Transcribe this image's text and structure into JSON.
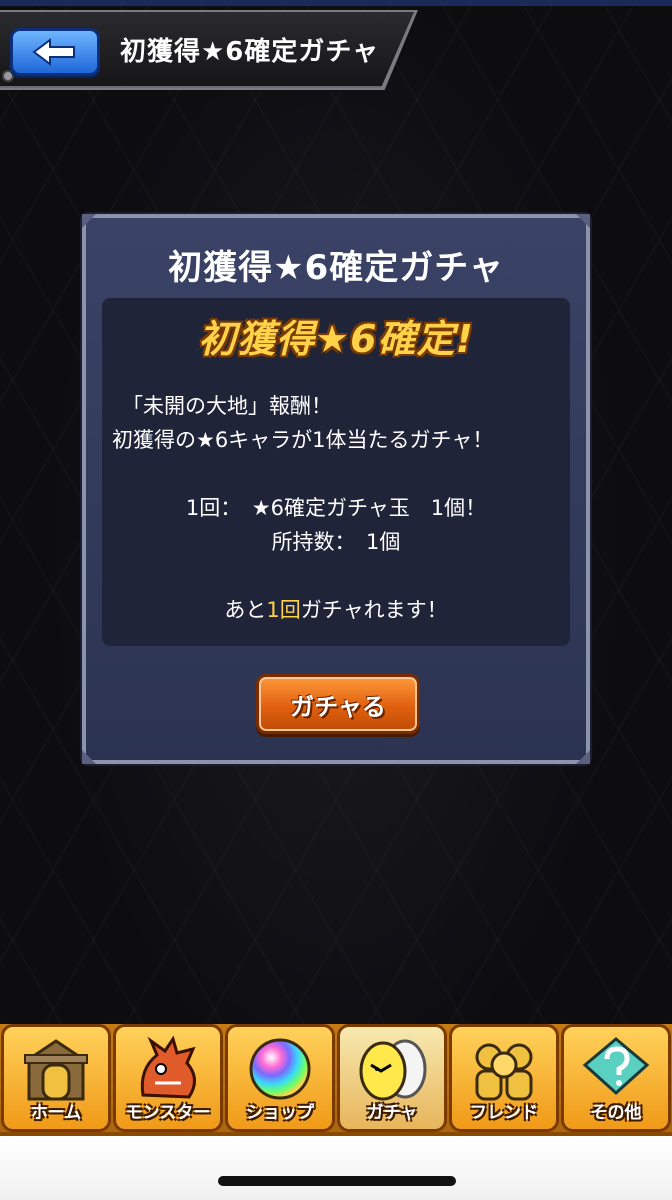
{
  "header": {
    "title": "初獲得★6確定ガチャ",
    "back_icon": "back-arrow-icon"
  },
  "dialog": {
    "title": "初獲得★6確定ガチャ",
    "headline": "初獲得★6確定!",
    "line1": "「未開の大地」報酬！",
    "line2": "初獲得の★6キャラが1体当たるガチャ！",
    "line3": "1回：　★6確定ガチャ玉　1個！",
    "line4": "所持数：　1個",
    "line5_pre": "あと",
    "line5_highlight": "1回",
    "line5_post": "ガチャれます！",
    "button_label": "ガチャる"
  },
  "nav": {
    "items": [
      {
        "label": "ホーム",
        "icon": "home-gate-icon"
      },
      {
        "label": "モンスター",
        "icon": "monster-dragon-icon"
      },
      {
        "label": "ショップ",
        "icon": "rainbow-orb-icon"
      },
      {
        "label": "ガチャ",
        "icon": "gacha-egg-icon"
      },
      {
        "label": "フレンド",
        "icon": "friends-icon"
      },
      {
        "label": "その他",
        "icon": "other-question-icon"
      }
    ],
    "active_index": 3
  },
  "colors": {
    "accent_gold": "#ffd24a",
    "button_orange": "#e0600f",
    "dialog_bg": "#3a4366",
    "back_blue": "#1f67d8"
  }
}
